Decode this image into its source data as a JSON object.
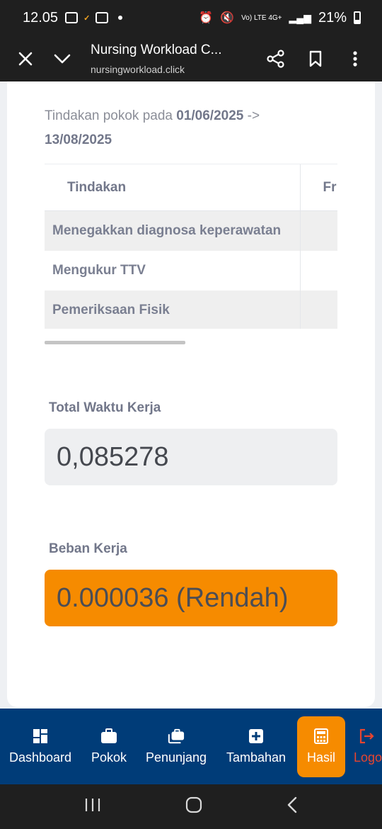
{
  "status_bar": {
    "time": "12.05",
    "network": "Vo) LTE  4G+",
    "battery": "21%"
  },
  "browser": {
    "title": "Nursing Workload C...",
    "url": "nursingworkload.click"
  },
  "period": {
    "prefix": "Tindakan pokok pada ",
    "start": "01/06/2025",
    "arrow": " ->",
    "end": "13/08/2025"
  },
  "table": {
    "headers": [
      "Tindakan",
      "Fr"
    ],
    "rows": [
      {
        "tindakan": "Menegakkan diagnosa keperawatan",
        "fr": ""
      },
      {
        "tindakan": "Mengukur TTV",
        "fr": ""
      },
      {
        "tindakan": "Pemeriksaan Fisik",
        "fr": ""
      }
    ]
  },
  "total_waktu": {
    "label": "Total Waktu Kerja",
    "value": "0,085278"
  },
  "beban": {
    "label": "Beban Kerja",
    "value": "0.000036 (Rendah)"
  },
  "nav": {
    "items": [
      {
        "label": "Dashboard",
        "icon": "dashboard-icon"
      },
      {
        "label": "Pokok",
        "icon": "briefcase-icon"
      },
      {
        "label": "Penunjang",
        "icon": "briefcases-icon"
      },
      {
        "label": "Tambahan",
        "icon": "plus-square-icon"
      },
      {
        "label": "Hasil",
        "icon": "calculator-icon"
      },
      {
        "label": "Logo",
        "icon": "logout-icon"
      }
    ]
  },
  "colors": {
    "accent": "#f68b00",
    "nav_bg": "#003c78",
    "logout": "#e8452f"
  }
}
